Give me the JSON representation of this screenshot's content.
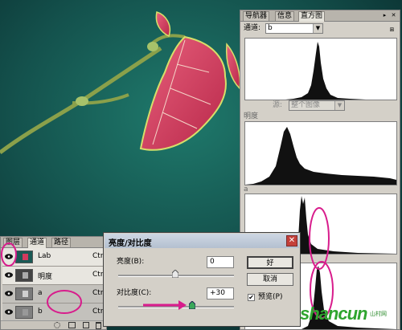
{
  "histogram_panel": {
    "tabs": [
      "导航器",
      "信息",
      "直方图"
    ],
    "channel_label": "通道:",
    "channel_value": "b",
    "source_label": "源:",
    "source_value": "整个图像",
    "section_brightness": "明度",
    "section_a": "a",
    "section_b": "b"
  },
  "layers_panel": {
    "tabs": [
      "图层",
      "通道",
      "路径"
    ],
    "rows": [
      {
        "name": "Lab",
        "shortcut": "Ctrl+"
      },
      {
        "name": "明度",
        "shortcut": "Ctrl+"
      },
      {
        "name": "a",
        "shortcut": "Ctrl+"
      },
      {
        "name": "b",
        "shortcut": "Ctrl+"
      }
    ]
  },
  "dialog": {
    "title": "亮度/对比度",
    "brightness_label": "亮度(B):",
    "brightness_value": "0",
    "contrast_label": "对比度(C):",
    "contrast_value": "+30",
    "ok_label": "好",
    "cancel_label": "取消",
    "preview_label": "预览(P)",
    "preview_checked": true,
    "brightness_level": 0,
    "contrast_level": 30
  },
  "watermark": {
    "text": "shancun",
    "sub": "山村网"
  },
  "colors": {
    "panel": "#d4d0c8",
    "annotation": "#d81c8c",
    "leaf": "#d23a5e"
  }
}
